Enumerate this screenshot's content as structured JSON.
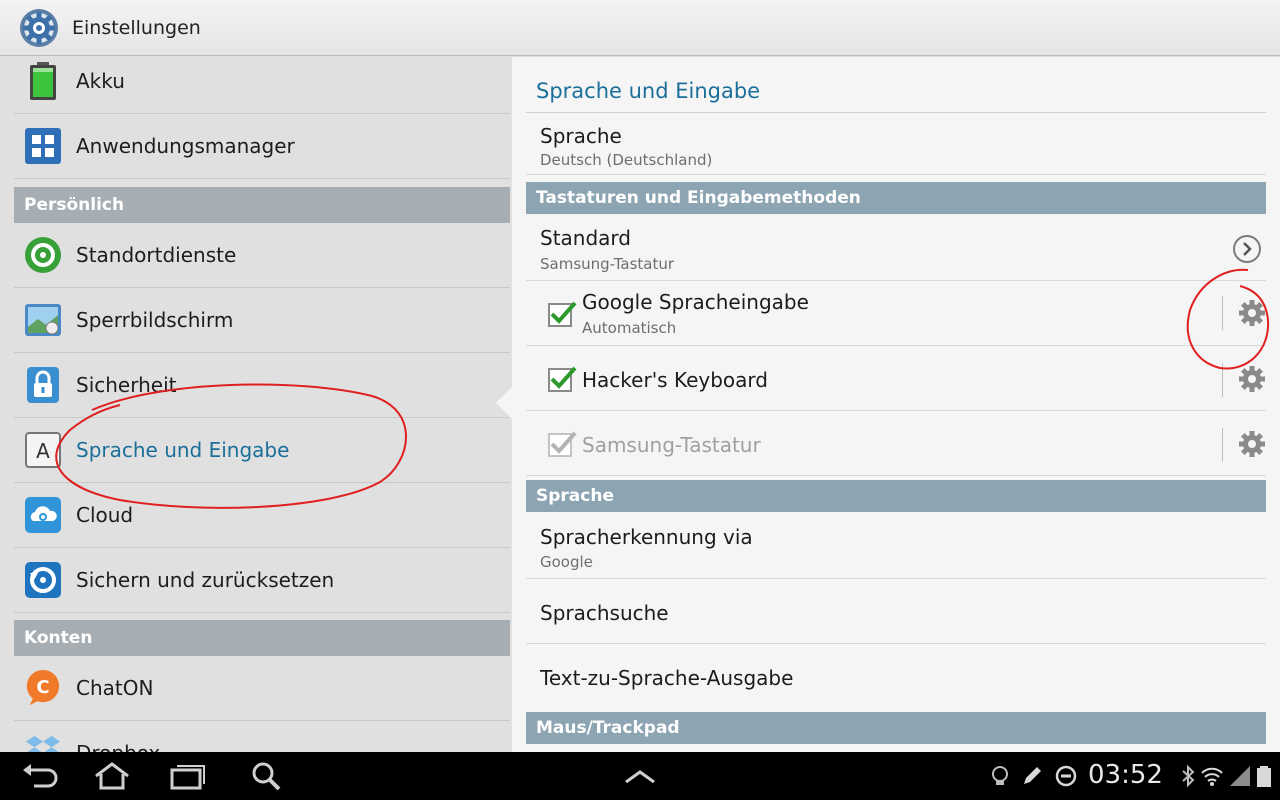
{
  "actionbar": {
    "title": "Einstellungen",
    "icon": "gear-settings-icon"
  },
  "left": {
    "items": [
      {
        "label": "Akku",
        "icon": "battery-icon"
      },
      {
        "label": "Anwendungsmanager",
        "icon": "apps-grid-icon"
      },
      {
        "label": "Standortdienste",
        "icon": "location-icon"
      },
      {
        "label": "Sperrbildschirm",
        "icon": "lockscreen-icon"
      },
      {
        "label": "Sicherheit",
        "icon": "lock-icon"
      },
      {
        "label": "Sprache und Eingabe",
        "icon": "keyboard-a-icon"
      },
      {
        "label": "Cloud",
        "icon": "cloud-icon"
      },
      {
        "label": "Sichern und zurücksetzen",
        "icon": "backup-icon"
      },
      {
        "label": "ChatON",
        "icon": "chaton-icon"
      },
      {
        "label": "Dropbox",
        "icon": "dropbox-icon"
      }
    ],
    "headers": {
      "personal": "Persönlich",
      "accounts": "Konten"
    },
    "active_index": 5
  },
  "right": {
    "section_title": "Sprache und Eingabe",
    "language": {
      "title": "Sprache",
      "subtitle": "Deutsch (Deutschland)"
    },
    "cat_keyboards": "Tastaturen und Eingabemethoden",
    "standard": {
      "title": "Standard",
      "subtitle": "Samsung-Tastatur"
    },
    "google_voice": {
      "title": "Google Spracheingabe",
      "subtitle": "Automatisch",
      "checked": true
    },
    "hackers_keyboard": {
      "title": "Hacker's Keyboard",
      "checked": true
    },
    "samsung_keyboard": {
      "title": "Samsung-Tastatur",
      "checked": true,
      "disabled": true
    },
    "cat_speech": "Sprache",
    "speech_recognition": {
      "title": "Spracherkennung via",
      "subtitle": "Google"
    },
    "voice_search": {
      "title": "Sprachsuche"
    },
    "tts": {
      "title": "Text-zu-Sprache-Ausgabe"
    },
    "cat_mouse": "Maus/Trackpad"
  },
  "sysbar": {
    "time": "03:52"
  },
  "colors": {
    "accent": "#1b6f9a",
    "category": "#8da4b2",
    "annotation": "#e02020"
  }
}
